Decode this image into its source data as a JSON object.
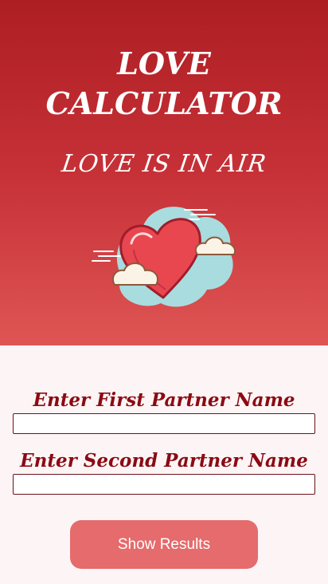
{
  "header": {
    "title_line1": "LOVE",
    "title_line2": "CALCULATOR",
    "tagline": "LOVE IS IN AIR"
  },
  "illustration": {
    "icon": "heart-with-clouds-icon",
    "colors": {
      "heart": "#e8474f",
      "heart_outline": "#a11d2b",
      "cloud_back": "#a8dcdf",
      "cloud_front": "#fbf3e6"
    }
  },
  "form": {
    "first_label": "Enter First Partner Name",
    "first_value": "",
    "second_label": "Enter Second Partner Name",
    "second_value": "",
    "button_label": "Show Results"
  },
  "theme": {
    "header_gradient_top": "#ad1e23",
    "header_gradient_bottom": "#df5554",
    "label_color": "#8b0a14",
    "button_color": "#e56b6c",
    "page_background": "#fdf5f5"
  }
}
